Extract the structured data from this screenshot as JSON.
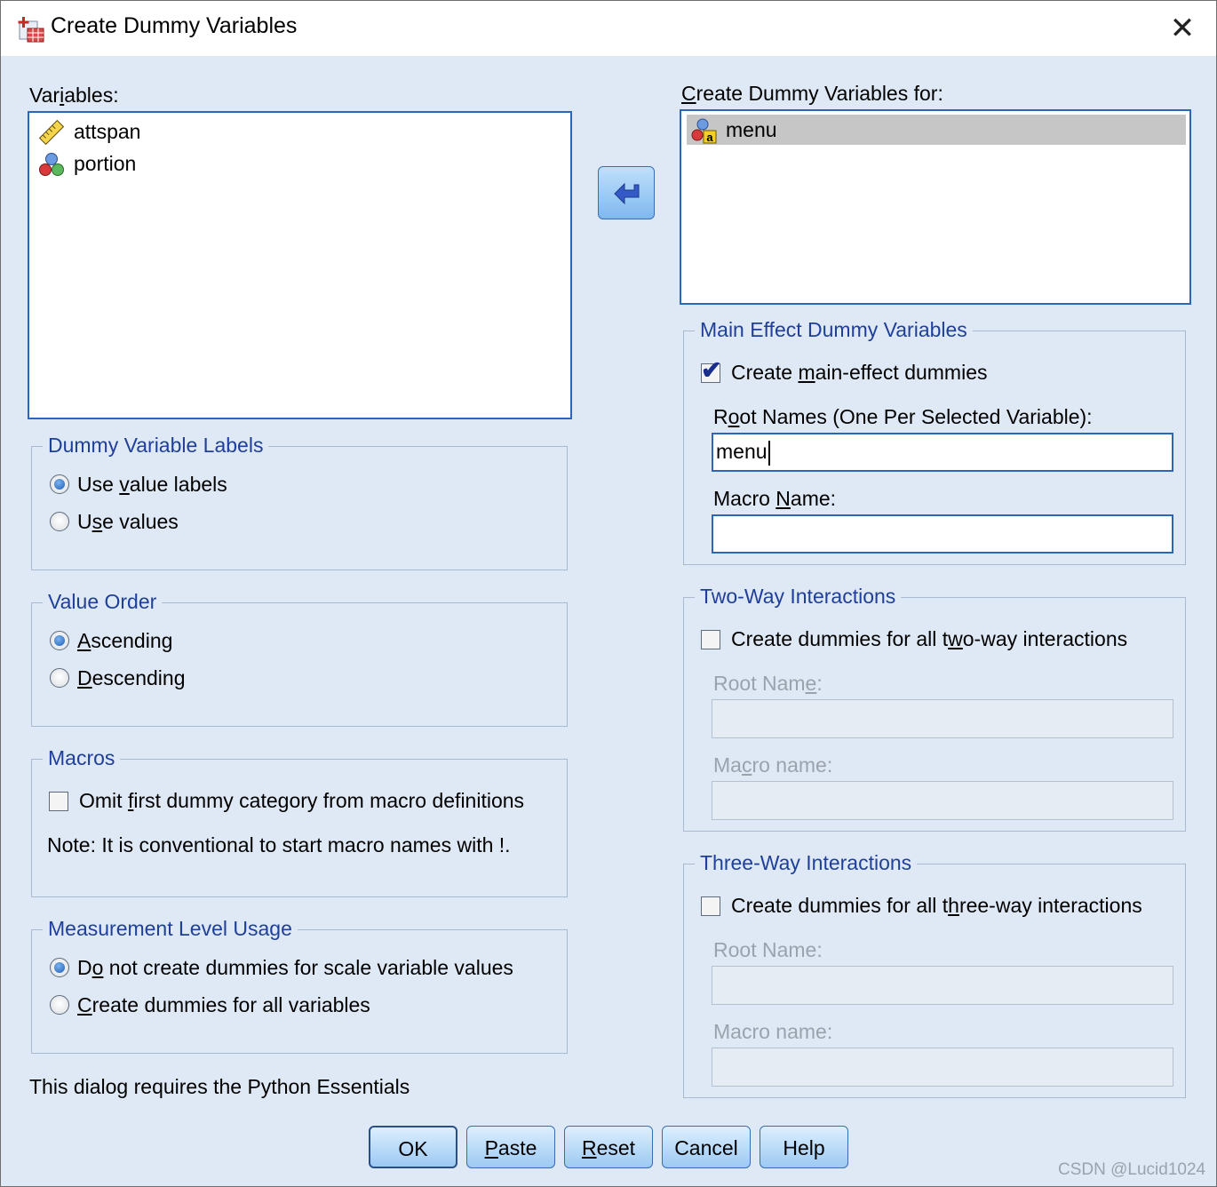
{
  "window": {
    "title": "Create Dummy Variables",
    "close_glyph": "✕"
  },
  "variables": {
    "label": "Variables:",
    "items": [
      {
        "name": "attspan",
        "icon": "ruler-scale-icon"
      },
      {
        "name": "portion",
        "icon": "nominal-balls-icon"
      }
    ]
  },
  "target": {
    "label": "Create Dummy Variables for:",
    "items": [
      {
        "name": "menu",
        "icon": "nominal-string-icon",
        "selected": true
      }
    ]
  },
  "labels_group": {
    "title": "Dummy Variable Labels",
    "options": [
      {
        "label": "Use value labels",
        "checked": true
      },
      {
        "label": "Use values",
        "checked": false
      }
    ]
  },
  "order_group": {
    "title": "Value Order",
    "options": [
      {
        "label": "Ascending",
        "checked": true
      },
      {
        "label": "Descending",
        "checked": false
      }
    ]
  },
  "macros_group": {
    "title": "Macros",
    "omit_label": "Omit first dummy category from macro definitions",
    "omit_checked": false,
    "note": "Note: It is conventional to start macro names with !."
  },
  "measurement_group": {
    "title": "Measurement Level Usage",
    "options": [
      {
        "label": "Do not create dummies for scale variable values",
        "checked": true
      },
      {
        "label": "Create dummies for all variables",
        "checked": false
      }
    ]
  },
  "requires_note": "This dialog requires the Python Essentials",
  "main_effect": {
    "title": "Main Effect Dummy Variables",
    "checkbox_label": "Create main-effect dummies",
    "checked": true,
    "root_label": "Root Names (One Per Selected Variable):",
    "root_value": "menu",
    "macro_label": "Macro Name:",
    "macro_value": ""
  },
  "two_way": {
    "title": "Two-Way Interactions",
    "checkbox_label": "Create dummies for all two-way interactions",
    "checked": false,
    "root_label": "Root Name:",
    "macro_label": "Macro name:"
  },
  "three_way": {
    "title": "Three-Way Interactions",
    "checkbox_label": "Create dummies for all three-way interactions",
    "checked": false,
    "root_label": "Root Name:",
    "macro_label": "Macro name:"
  },
  "buttons": {
    "ok": "OK",
    "paste": "Paste",
    "reset": "Reset",
    "cancel": "Cancel",
    "help": "Help"
  },
  "watermark": "CSDN @Lucid1024",
  "colors": {
    "dialog_bg": "#dfe9f5",
    "group_title": "#1f3f99",
    "list_border": "#2b66b8",
    "selection": "#c6c6c6"
  }
}
